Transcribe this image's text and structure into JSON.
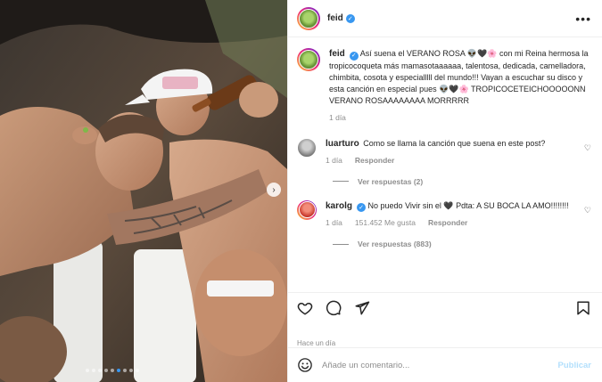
{
  "post": {
    "author": "feid",
    "caption": "Así suena el VERANO ROSA 👽🖤🌸 con mi Reina hermosa la tropicocoqueta más mamasotaaaaaa, talentosa, dedicada, camelladora, chimbita, cosota y especialllll del mundo!!! Vayan a escuchar su disco y esta canción en especial pues 👽🖤🌸 TROPICOCETEICHOOOOONN VERANO ROSAAAAAAAA MORRRRR",
    "caption_time": "1 día",
    "posted_ago": "Hace un día"
  },
  "comments": [
    {
      "user": "luarturo",
      "text": "Como se llama la canción que suena en este post?",
      "time": "1 día",
      "reply_label": "Responder",
      "view_replies": "Ver respuestas (2)"
    },
    {
      "user": "karolg",
      "text": "No puedo Vivir sin el 🖤 Pdta: A SU BOCA LA AMO!!!!!!!!",
      "time": "1 día",
      "likes": "151.452 Me gusta",
      "reply_label": "Responder",
      "view_replies": "Ver respuestas (883)"
    }
  ],
  "add_comment": {
    "placeholder": "Añade un comentario...",
    "publish_label": "Publicar"
  },
  "icons": {
    "more": "more-options-icon",
    "like": "heart-icon",
    "comment": "comment-icon",
    "share": "share-icon",
    "save": "bookmark-icon",
    "emoji": "emoji-icon"
  },
  "colors": {
    "verified": "#3897f0",
    "muted": "#8e8e8e",
    "publish": "#b2dffc"
  },
  "carousel": {
    "total_slides": 9,
    "active_slide": 6
  }
}
